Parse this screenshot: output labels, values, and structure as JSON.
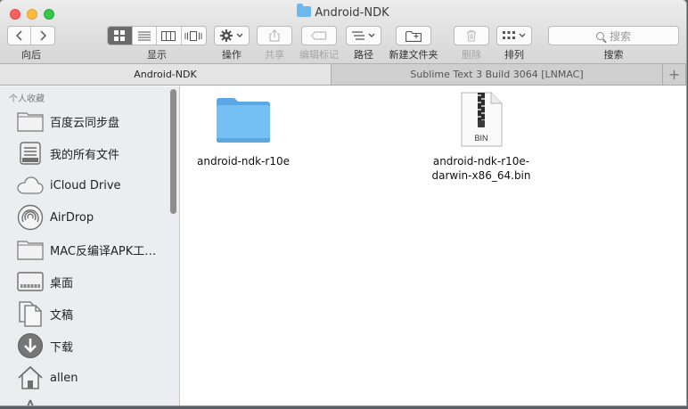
{
  "window": {
    "title": "Android-NDK"
  },
  "toolbar": {
    "back_label": "向后",
    "view_label": "显示",
    "action_label": "操作",
    "share_label": "共享",
    "tags_label": "编辑标记",
    "path_label": "路径",
    "new_folder_label": "新建文件夹",
    "delete_label": "删除",
    "arrange_label": "排列",
    "search_label": "搜索",
    "search_placeholder": "搜索"
  },
  "tabs": [
    {
      "label": "Android-NDK",
      "active": true
    },
    {
      "label": "Sublime Text 3 Build 3064 [LNMAC]",
      "active": false
    }
  ],
  "sidebar": {
    "header": "个人收藏",
    "items": [
      {
        "label": "百度云同步盘",
        "icon": "folder-icon"
      },
      {
        "label": "我的所有文件",
        "icon": "all-files-icon"
      },
      {
        "label": "iCloud Drive",
        "icon": "cloud-icon"
      },
      {
        "label": "AirDrop",
        "icon": "airdrop-icon"
      },
      {
        "label": "MAC反编译APK工…",
        "icon": "folder-icon"
      },
      {
        "label": "桌面",
        "icon": "desktop-icon"
      },
      {
        "label": "文稿",
        "icon": "documents-icon"
      },
      {
        "label": "下载",
        "icon": "download-icon"
      },
      {
        "label": "allen",
        "icon": "home-icon"
      }
    ]
  },
  "files": [
    {
      "name": "android-ndk-r10e",
      "type": "folder"
    },
    {
      "name": "android-ndk-r10e-darwin-x86_64.bin",
      "name_line1": "android-ndk-r10e-",
      "name_line2": "darwin-x86_64.bin",
      "badge": "BIN",
      "type": "bin"
    }
  ],
  "colors": {
    "folder": "#6db8ef",
    "selected_view": "#6b6b6b"
  }
}
